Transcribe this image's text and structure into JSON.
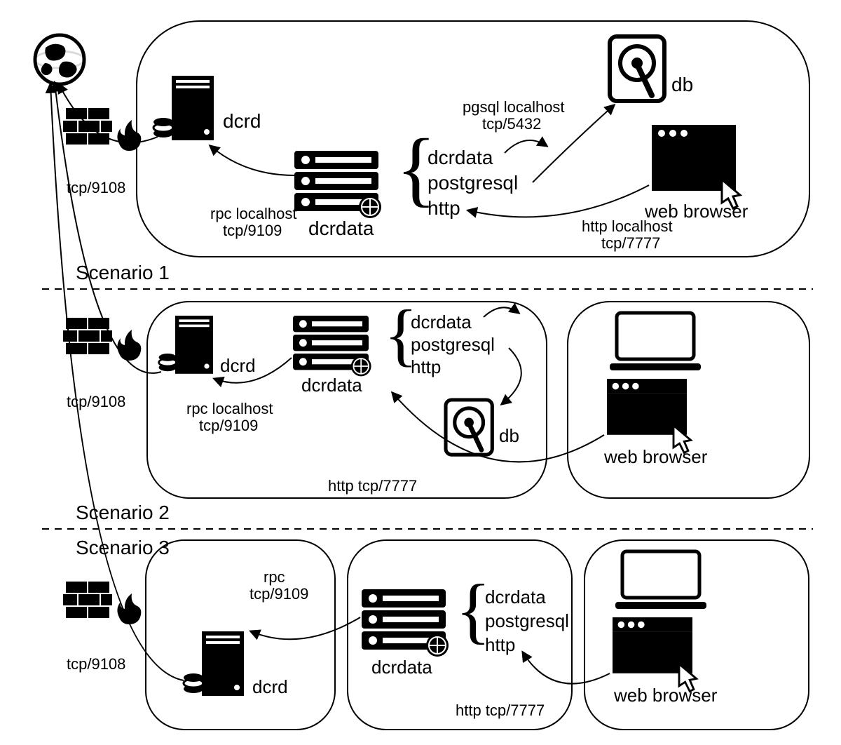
{
  "scenario_labels": {
    "s1": "Scenario 1",
    "s2": "Scenario 2",
    "s3": "Scenario 3"
  },
  "node_labels": {
    "dcrd": "dcrd",
    "dcrdata": "dcrdata",
    "db": "db",
    "web_browser": "web browser",
    "services": {
      "dcrdata": "dcrdata",
      "postgresql": "postgresql",
      "http": "http"
    }
  },
  "connections": {
    "tcp_9108": "tcp/9108",
    "rpc_localhost_9109_l1": "rpc localhost",
    "rpc_localhost_9109_l2": "tcp/9109",
    "pgsql_localhost_l1": "pgsql localhost",
    "pgsql_localhost_l2": "tcp/5432",
    "http_localhost_l1": "http localhost",
    "http_localhost_l2": "tcp/7777",
    "http_7777": "http tcp/7777",
    "rpc_l1": "rpc",
    "rpc_l2": "tcp/9109"
  }
}
